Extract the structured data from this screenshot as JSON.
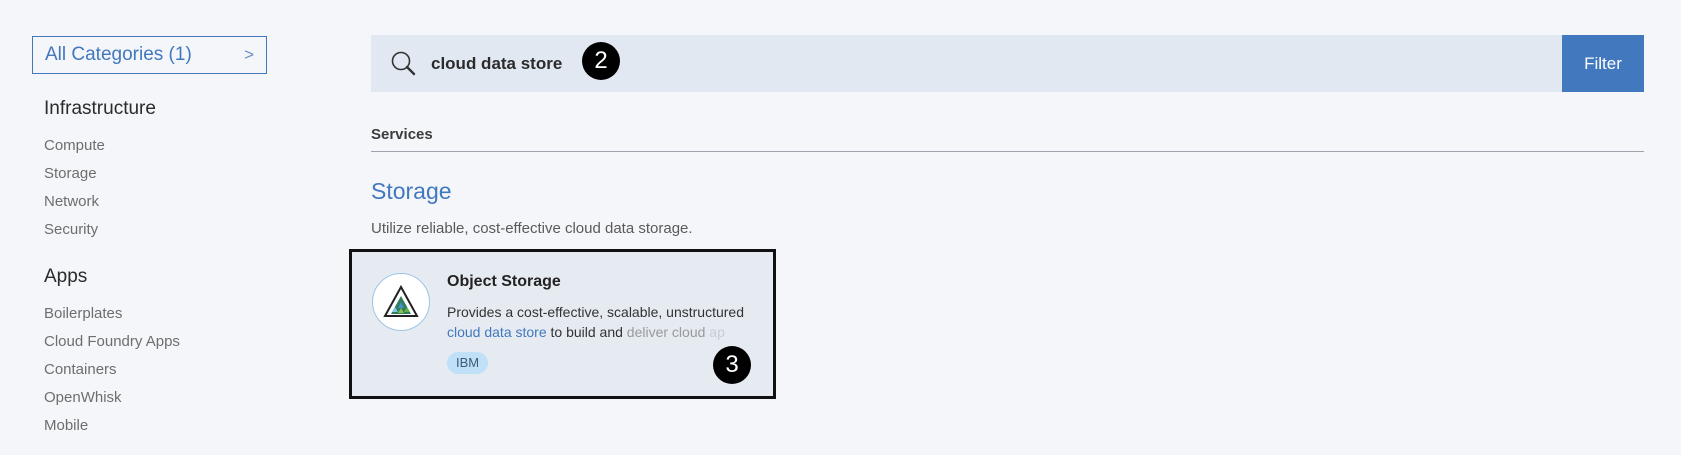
{
  "sidebar": {
    "category_select": {
      "label": "All Categories (1)",
      "chevron": ">"
    },
    "sections": [
      {
        "heading": "Infrastructure",
        "items": [
          "Compute",
          "Storage",
          "Network",
          "Security"
        ]
      },
      {
        "heading": "Apps",
        "items": [
          "Boilerplates",
          "Cloud Foundry Apps",
          "Containers",
          "OpenWhisk",
          "Mobile"
        ]
      }
    ]
  },
  "search": {
    "icon": "search-icon",
    "value": "cloud data store",
    "filter_label": "Filter"
  },
  "annotations": {
    "step2": "2",
    "step3": "3"
  },
  "main": {
    "services_label": "Services",
    "section_title": "Storage",
    "section_desc": "Utilize reliable, cost-effective cloud data storage.",
    "card": {
      "title": "Object Storage",
      "desc_part1": "Provides a cost-effective, scalable, unstructured",
      "desc_highlight": "cloud data store",
      "desc_part2": " to build and ",
      "desc_fade1": "deliver cloud",
      "desc_fade2": " ap",
      "tag": "IBM",
      "logo_icon": "object-storage-logo-icon"
    }
  },
  "colors": {
    "accent": "#4178be",
    "background": "#f4f6fa",
    "search_bg": "#e2e8f1",
    "card_bg": "#e6ebf2",
    "tag_bg": "#bfe0f7"
  }
}
